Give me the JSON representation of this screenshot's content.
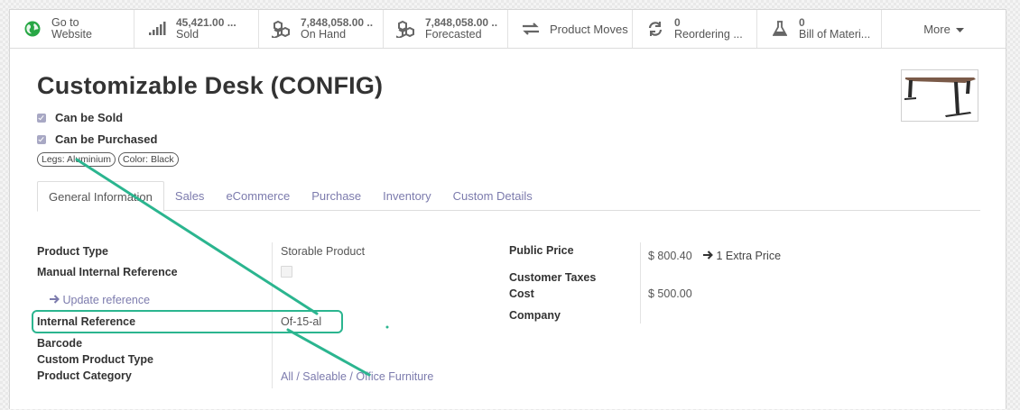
{
  "stat_buttons": [
    {
      "name": "go-to-website-button",
      "icon": "globe-icon",
      "value": "Go to",
      "label": "Website",
      "iconColor": "#28a745"
    },
    {
      "name": "sold-button",
      "icon": "signal-bars-icon",
      "value": "45,421.00 ...",
      "label": "Sold"
    },
    {
      "name": "on-hand-button",
      "icon": "cubes-icon",
      "value": "7,848,058.00 ..",
      "label": "On Hand"
    },
    {
      "name": "forecasted-button",
      "icon": "cubes-icon",
      "value": "7,848,058.00 ..",
      "label": "Forecasted"
    },
    {
      "name": "product-moves-button",
      "icon": "exchange-arrows-icon",
      "label": "Product Moves"
    },
    {
      "name": "reordering-button",
      "icon": "refresh-icon",
      "value": "0",
      "label": "Reordering ..."
    },
    {
      "name": "bill-of-materials-button",
      "icon": "flask-icon",
      "value": "0",
      "label": "Bill of Materi..."
    }
  ],
  "more_label": "More",
  "product": {
    "title": "Customizable Desk (CONFIG)",
    "can_be_sold": "Can be Sold",
    "can_be_purchased": "Can be Purchased",
    "tags": [
      "Legs: Aluminium",
      "Color: Black"
    ]
  },
  "tabs": [
    "General Information",
    "Sales",
    "eCommerce",
    "Purchase",
    "Inventory",
    "Custom Details"
  ],
  "fields": {
    "product_type_label": "Product Type",
    "product_type_value": "Storable Product",
    "manual_ref_label": "Manual Internal Reference",
    "update_reference": "Update reference",
    "internal_ref_label": "Internal Reference",
    "internal_ref_value": "Of-15-al",
    "barcode_label": "Barcode",
    "custom_product_type_label": "Custom Product Type",
    "product_category_label": "Product Category",
    "product_category_value": "All / Saleable / Office Furniture",
    "public_price_label": "Public Price",
    "public_price_value": "$ 800.40",
    "extra_price": "1 Extra Price",
    "customer_taxes_label": "Customer Taxes",
    "cost_label": "Cost",
    "cost_value": "$ 500.00",
    "company_label": "Company"
  },
  "colors": {
    "accent": "#7c7bad",
    "highlight": "#2bb58f",
    "checkbox": "#a8a8c4"
  }
}
